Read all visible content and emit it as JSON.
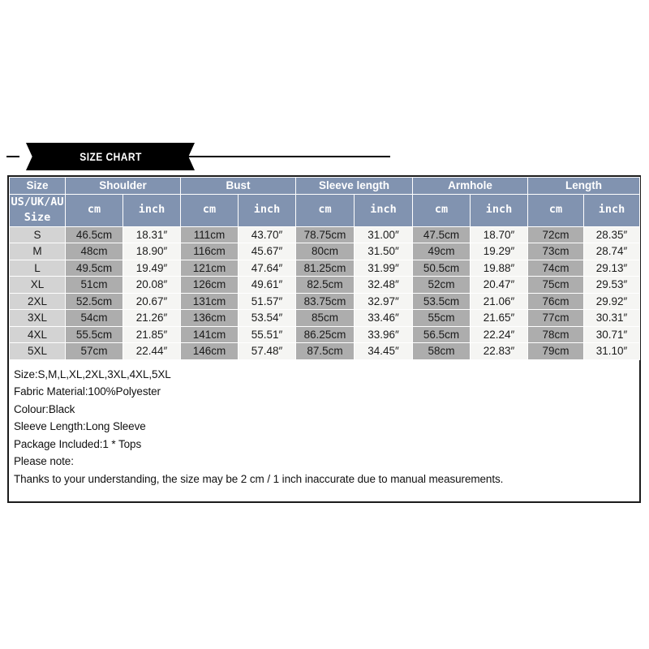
{
  "banner": {
    "title": "SIZE CHART"
  },
  "table": {
    "group_headers": [
      "Size",
      "Shoulder",
      "Bust",
      "Sleeve length",
      "Armhole",
      "Length"
    ],
    "size_subheader": "US/UK/AU\nSize",
    "size_subheader_line1": "US/UK/AU",
    "size_subheader_line2": "Size",
    "unit_headers": [
      "cm",
      "inch",
      "cm",
      "inch",
      "cm",
      "inch",
      "cm",
      "inch",
      "cm",
      "inch"
    ],
    "rows": [
      {
        "size": "S",
        "shoulder_cm": "46.5cm",
        "shoulder_in": "18.31″",
        "bust_cm": "111cm",
        "bust_in": "43.70″",
        "sleeve_cm": "78.75cm",
        "sleeve_in": "31.00″",
        "armhole_cm": "47.5cm",
        "armhole_in": "18.70″",
        "length_cm": "72cm",
        "length_in": "28.35″"
      },
      {
        "size": "M",
        "shoulder_cm": "48cm",
        "shoulder_in": "18.90″",
        "bust_cm": "116cm",
        "bust_in": "45.67″",
        "sleeve_cm": "80cm",
        "sleeve_in": "31.50″",
        "armhole_cm": "49cm",
        "armhole_in": "19.29″",
        "length_cm": "73cm",
        "length_in": "28.74″"
      },
      {
        "size": "L",
        "shoulder_cm": "49.5cm",
        "shoulder_in": "19.49″",
        "bust_cm": "121cm",
        "bust_in": "47.64″",
        "sleeve_cm": "81.25cm",
        "sleeve_in": "31.99″",
        "armhole_cm": "50.5cm",
        "armhole_in": "19.88″",
        "length_cm": "74cm",
        "length_in": "29.13″"
      },
      {
        "size": "XL",
        "shoulder_cm": "51cm",
        "shoulder_in": "20.08″",
        "bust_cm": "126cm",
        "bust_in": "49.61″",
        "sleeve_cm": "82.5cm",
        "sleeve_in": "32.48″",
        "armhole_cm": "52cm",
        "armhole_in": "20.47″",
        "length_cm": "75cm",
        "length_in": "29.53″"
      },
      {
        "size": "2XL",
        "shoulder_cm": "52.5cm",
        "shoulder_in": "20.67″",
        "bust_cm": "131cm",
        "bust_in": "51.57″",
        "sleeve_cm": "83.75cm",
        "sleeve_in": "32.97″",
        "armhole_cm": "53.5cm",
        "armhole_in": "21.06″",
        "length_cm": "76cm",
        "length_in": "29.92″"
      },
      {
        "size": "3XL",
        "shoulder_cm": "54cm",
        "shoulder_in": "21.26″",
        "bust_cm": "136cm",
        "bust_in": "53.54″",
        "sleeve_cm": "85cm",
        "sleeve_in": "33.46″",
        "armhole_cm": "55cm",
        "armhole_in": "21.65″",
        "length_cm": "77cm",
        "length_in": "30.31″"
      },
      {
        "size": "4XL",
        "shoulder_cm": "55.5cm",
        "shoulder_in": "21.85″",
        "bust_cm": "141cm",
        "bust_in": "55.51″",
        "sleeve_cm": "86.25cm",
        "sleeve_in": "33.96″",
        "armhole_cm": "56.5cm",
        "armhole_in": "22.24″",
        "length_cm": "78cm",
        "length_in": "30.71″"
      },
      {
        "size": "5XL",
        "shoulder_cm": "57cm",
        "shoulder_in": "22.44″",
        "bust_cm": "146cm",
        "bust_in": "57.48″",
        "sleeve_cm": "87.5cm",
        "sleeve_in": "34.45″",
        "armhole_cm": "58cm",
        "armhole_in": "22.83″",
        "length_cm": "79cm",
        "length_in": "31.10″"
      }
    ]
  },
  "notes": [
    "Size:S,M,L,XL,2XL,3XL,4XL,5XL",
    "Fabric Material:100%Polyester",
    "Colour:Black",
    "Sleeve Length:Long Sleeve",
    "Package Included:1 * Tops",
    "Please note:",
    "Thanks to your understanding, the size may be 2 cm / 1 inch inaccurate due to manual measurements."
  ],
  "colors": {
    "header_blue": "#8193b0",
    "cm_cell": "#adadad",
    "inch_cell": "#f5f5f3",
    "size_cell": "#d3d3d3",
    "banner_black": "#000000",
    "card_border": "#1b1b1b"
  }
}
